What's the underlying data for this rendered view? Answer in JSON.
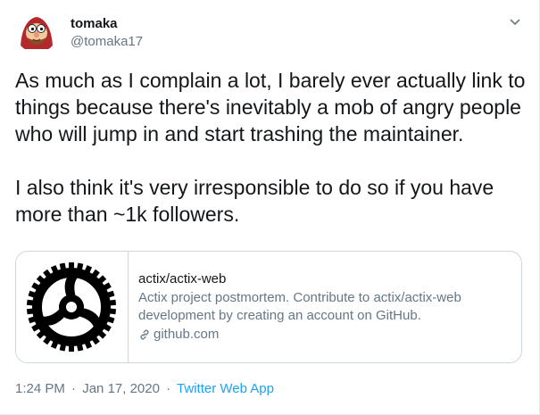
{
  "author": {
    "name": "tomaka",
    "handle": "@tomaka17"
  },
  "tweet": {
    "text": "As much as I complain a lot, I barely ever actually link to things because there's inevitably a mob of angry people who will jump in and start trashing the maintainer.\n\nI also think it's very irresponsible to do so if you have more than ~1k followers."
  },
  "card": {
    "title": "actix/actix-web",
    "description": "Actix project postmortem. Contribute to actix/actix-web development by creating an account on GitHub.",
    "domain": "github.com",
    "thumbnail_icon": "gear-logo-icon"
  },
  "meta": {
    "time": "1:24 PM",
    "separator": "·",
    "date": "Jan 17, 2020",
    "source": "Twitter Web App"
  },
  "colors": {
    "text": "#14171a",
    "secondary": "#657786",
    "link": "#1da1f2",
    "border": "#ccd6dd"
  }
}
